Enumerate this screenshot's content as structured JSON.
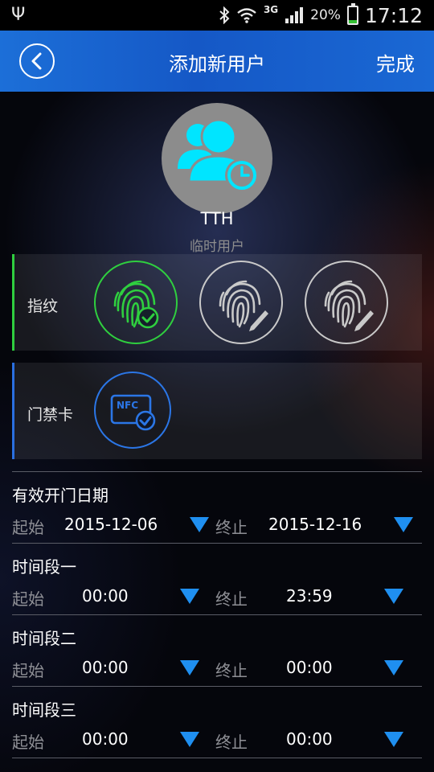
{
  "status_bar": {
    "usb_icon": "usb-icon",
    "network_type": "3G",
    "battery_percent": "20%",
    "battery_level": 0.2,
    "time": "17:12"
  },
  "header": {
    "title": "添加新用户",
    "done_label": "完成",
    "back_icon": "back-arrow-icon"
  },
  "user": {
    "name": "TTH",
    "type": "临时用户",
    "avatar_icon": "temporary-user-icon"
  },
  "fingerprint_panel": {
    "label": "指纹",
    "slots": [
      {
        "icon": "fingerprint-check-icon",
        "status": "registered",
        "color": "#2fcf3f"
      },
      {
        "icon": "fingerprint-edit-icon",
        "status": "empty",
        "color": "#c9c9c9"
      },
      {
        "icon": "fingerprint-edit-icon",
        "status": "empty",
        "color": "#c9c9c9"
      }
    ]
  },
  "card_panel": {
    "label": "门禁卡",
    "icon_text": "NFC",
    "icon": "nfc-card-check-icon",
    "color": "#2b76e6"
  },
  "schedule": {
    "dates": {
      "title": "有效开门日期",
      "start_label": "起始",
      "start_value": "2015-12-06",
      "end_label": "终止",
      "end_value": "2015-12-16"
    },
    "periods": [
      {
        "title": "时间段一",
        "start_label": "起始",
        "start_value": "00:00",
        "end_label": "终止",
        "end_value": "23:59"
      },
      {
        "title": "时间段二",
        "start_label": "起始",
        "start_value": "00:00",
        "end_label": "终止",
        "end_value": "00:00"
      },
      {
        "title": "时间段三",
        "start_label": "起始",
        "start_value": "00:00",
        "end_label": "终止",
        "end_value": "00:00"
      }
    ]
  },
  "colors": {
    "header_blue": "#1558c6",
    "accent_blue": "#1f8ff0",
    "success_green": "#2fcf3f",
    "avatar_cyan": "#00e5ff"
  }
}
